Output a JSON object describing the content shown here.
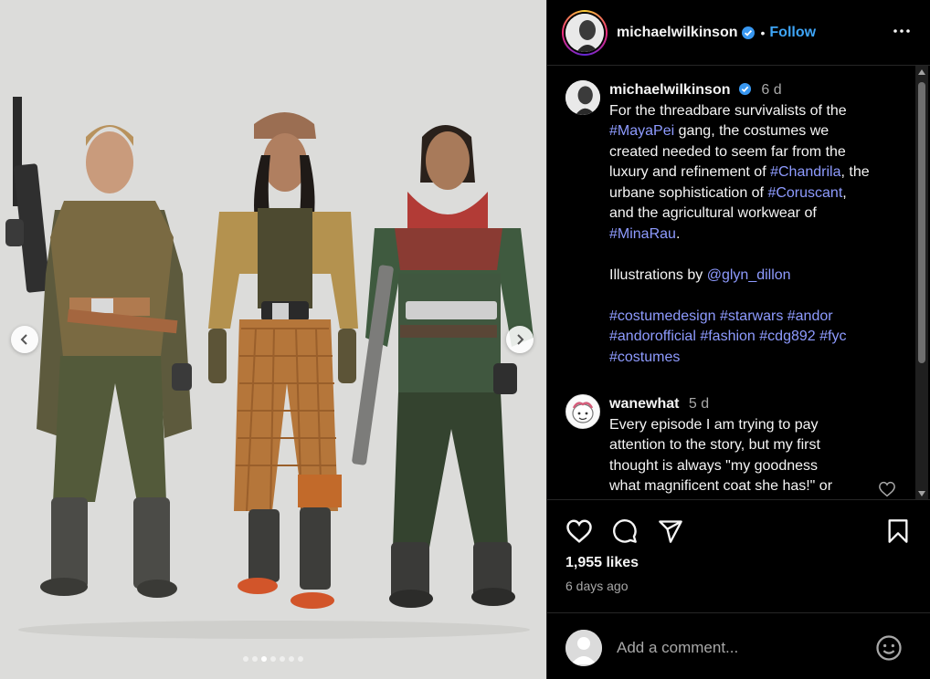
{
  "post": {
    "author": "michaelwilkinson",
    "follow_label": "Follow",
    "separator": "•",
    "caption": {
      "time": "6 d",
      "l1": "For the threadbare survivalists of the",
      "tag_mayapei": "#MayaPei",
      "l2_rest": " gang, the costumes we",
      "l3": "created needed to seem far from the",
      "l4_pre": "luxury and refinement of ",
      "tag_chandrila": "#Chandrila",
      "l4_post": ", the",
      "l5_pre": "urbane sophistication of ",
      "tag_coruscant": "#Coruscant",
      "l5_post": ",",
      "l6": "and the agricultural workwear of",
      "tag_minarau": "#MinaRau",
      "l7_post": ".",
      "illus_pre": "Illustrations by ",
      "illus_handle": "@glyn_dillon",
      "tags_1": "#costumedesign #starwars #andor",
      "tags_2": "#andorofficial #fashion #cdg892 #fyc",
      "tags_3": "#costumes"
    },
    "comment": {
      "author": "wanewhat",
      "time": "5 d",
      "l1": "Every episode I am trying to pay",
      "l2": "attention to the story, but my first",
      "l3": "thought is always \"my goodness",
      "l4": "what magnificent coat she has!\" or"
    },
    "likes": "1,955 likes",
    "posted_ago": "6 days ago",
    "add_comment_placeholder": "Add a comment...",
    "carousel": {
      "total": 7,
      "active_index": 2
    }
  },
  "icons": {
    "verified": "verified-badge-icon",
    "more": "more-options-icon",
    "like": "heart-icon",
    "comment": "comment-icon",
    "share": "share-icon",
    "save": "bookmark-icon",
    "emoji": "emoji-icon",
    "prev": "chevron-left-icon",
    "next": "chevron-right-icon"
  },
  "colors": {
    "background": "#000000",
    "link": "#3ea5f7",
    "hashtag": "#8e9bff",
    "muted": "#a8a8a8",
    "media_backdrop": "#dcdcda"
  }
}
